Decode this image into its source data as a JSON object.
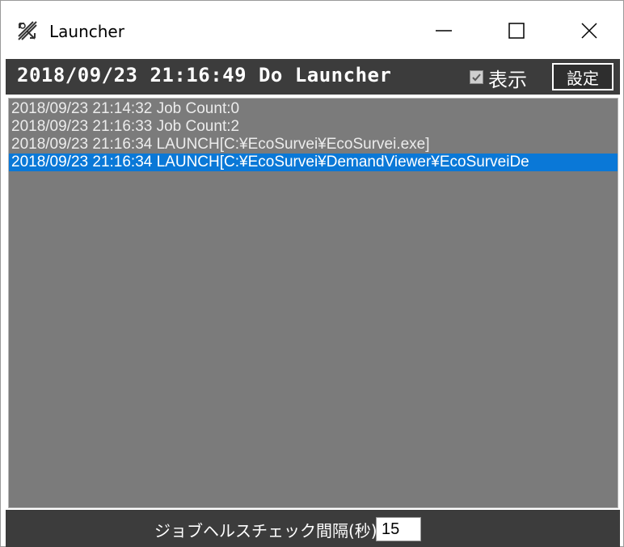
{
  "window": {
    "title": "Launcher",
    "icons": {
      "app": "launcher-app-icon",
      "minimize": "minimize-icon",
      "maximize": "maximize-icon",
      "close": "close-icon"
    }
  },
  "header": {
    "title": "2018/09/23 21:16:49 Do Launcher",
    "show_checkbox": {
      "label": "表示",
      "checked": true
    },
    "settings_label": "設定"
  },
  "log": {
    "items": [
      {
        "text": "2018/09/23 21:14:32 Job Count:0",
        "selected": false
      },
      {
        "text": "2018/09/23 21:16:33 Job Count:2",
        "selected": false
      },
      {
        "text": "2018/09/23 21:16:34 LAUNCH[C:¥EcoSurvei¥EcoSurvei.exe]",
        "selected": false
      },
      {
        "text": "2018/09/23 21:16:34 LAUNCH[C:¥EcoSurvei¥DemandViewer¥EcoSurveiDe",
        "selected": true
      }
    ]
  },
  "footer": {
    "interval_label": "ジョブヘルスチェック間隔(秒)",
    "interval_value": "15"
  },
  "colors": {
    "header_bg": "#3c3c3c",
    "list_bg": "#7b7b7b",
    "selection": "#0a78d7",
    "text_light": "#ececec"
  }
}
